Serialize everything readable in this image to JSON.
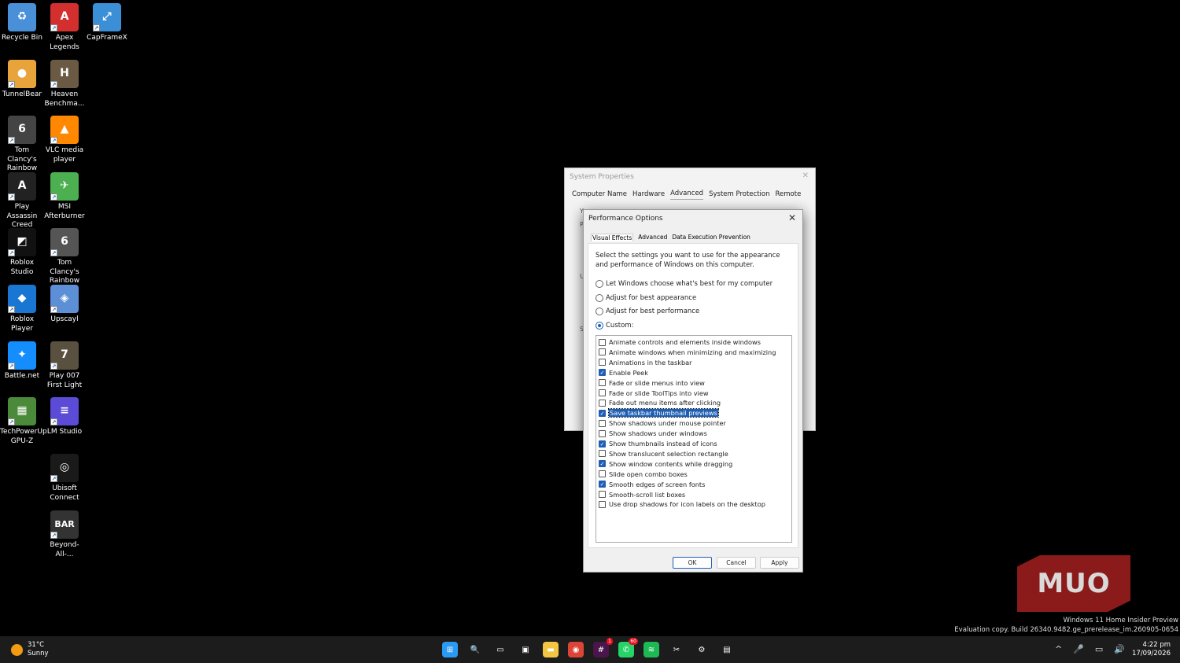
{
  "desktop_icons": [
    {
      "label": "Recycle Bin",
      "icon": "recycle-bin-icon",
      "color": "#4a90d9",
      "glyph": "♻"
    },
    {
      "label": "Apex Legends",
      "icon": "apex-legends-icon",
      "color": "#d32f2f",
      "glyph": "A"
    },
    {
      "label": "CapFrameX",
      "icon": "capframex-icon",
      "color": "#3b8fd6",
      "glyph": "⤢"
    },
    {
      "label": "TunnelBear",
      "icon": "tunnelbear-icon",
      "color": "#e8a33a",
      "glyph": "●"
    },
    {
      "label": "Heaven Benchma...",
      "icon": "heaven-benchmark-icon",
      "color": "#6b5a43",
      "glyph": "H"
    },
    {
      "label": "Tom Clancy's Rainbow Si...",
      "icon": "rainbow-six-icon",
      "color": "#444444",
      "glyph": "6"
    },
    {
      "label": "VLC media player",
      "icon": "vlc-icon",
      "color": "#ff8800",
      "glyph": "▲"
    },
    {
      "label": "Play Assassin Creed Blac...",
      "icon": "assassins-creed-icon",
      "color": "#222222",
      "glyph": "A"
    },
    {
      "label": "MSI Afterburner",
      "icon": "msi-afterburner-icon",
      "color": "#4caf50",
      "glyph": "✈"
    },
    {
      "label": "Roblox Studio",
      "icon": "roblox-studio-icon",
      "color": "#111111",
      "glyph": "◩"
    },
    {
      "label": "Tom Clancy's Rainbow Si...",
      "icon": "rainbow-six-siege-icon",
      "color": "#555555",
      "glyph": "6"
    },
    {
      "label": "Roblox Player",
      "icon": "roblox-player-icon",
      "color": "#1976d2",
      "glyph": "◆"
    },
    {
      "label": "Upscayl",
      "icon": "upscayl-icon",
      "color": "#5c8fd6",
      "glyph": "◈"
    },
    {
      "label": "Battle.net",
      "icon": "battlenet-icon",
      "color": "#148eff",
      "glyph": "✦"
    },
    {
      "label": "Play 007 First Light",
      "icon": "007-first-light-icon",
      "color": "#5a5040",
      "glyph": "7"
    },
    {
      "label": "TechPowerUp GPU-Z",
      "icon": "gpu-z-icon",
      "color": "#4a8a3a",
      "glyph": "▦"
    },
    {
      "label": "LM Studio",
      "icon": "lm-studio-icon",
      "color": "#5b4bd6",
      "glyph": "≡"
    },
    {
      "label": "Ubisoft Connect",
      "icon": "ubisoft-connect-icon",
      "color": "#1a1a1a",
      "glyph": "◎"
    },
    {
      "label": "Beyond-All-...",
      "icon": "beyond-all-reason-icon",
      "color": "#333333",
      "glyph": "BAR"
    }
  ],
  "system_properties": {
    "title": "System Properties",
    "tabs": [
      "Computer Name",
      "Hardware",
      "Advanced",
      "System Protection",
      "Remote"
    ],
    "active_tab": "Advanced"
  },
  "performance_options": {
    "title": "Performance Options",
    "tabs": [
      "Visual Effects",
      "Advanced",
      "Data Execution Prevention"
    ],
    "active_tab": "Visual Effects",
    "description": "Select the settings you want to use for the appearance and performance of Windows on this computer.",
    "radio_options": [
      {
        "label": "Let Windows choose what's best for my computer",
        "selected": false
      },
      {
        "label": "Adjust for best appearance",
        "selected": false
      },
      {
        "label": "Adjust for best performance",
        "selected": false
      },
      {
        "label": "Custom:",
        "selected": true
      }
    ],
    "effects": [
      {
        "label": "Animate controls and elements inside windows",
        "checked": false
      },
      {
        "label": "Animate windows when minimizing and maximizing",
        "checked": false
      },
      {
        "label": "Animations in the taskbar",
        "checked": false
      },
      {
        "label": "Enable Peek",
        "checked": true
      },
      {
        "label": "Fade or slide menus into view",
        "checked": false
      },
      {
        "label": "Fade or slide ToolTips into view",
        "checked": false
      },
      {
        "label": "Fade out menu items after clicking",
        "checked": false
      },
      {
        "label": "Save taskbar thumbnail previews",
        "checked": true,
        "highlighted": true
      },
      {
        "label": "Show shadows under mouse pointer",
        "checked": false
      },
      {
        "label": "Show shadows under windows",
        "checked": false
      },
      {
        "label": "Show thumbnails instead of icons",
        "checked": true
      },
      {
        "label": "Show translucent selection rectangle",
        "checked": false
      },
      {
        "label": "Show window contents while dragging",
        "checked": true
      },
      {
        "label": "Slide open combo boxes",
        "checked": false
      },
      {
        "label": "Smooth edges of screen fonts",
        "checked": true
      },
      {
        "label": "Smooth-scroll list boxes",
        "checked": false
      },
      {
        "label": "Use drop shadows for icon labels on the desktop",
        "checked": false
      }
    ],
    "buttons": {
      "ok": "OK",
      "cancel": "Cancel",
      "apply": "Apply"
    }
  },
  "watermark": {
    "logo": "MUO",
    "windows_line1": "Windows 11 Home Insider Preview",
    "windows_line2": "Evaluation copy. Build 26340.9482.ge_prerelease_im.260905-0654"
  },
  "taskbar": {
    "weather_temp": "31°C",
    "weather_desc": "Sunny",
    "apps": [
      {
        "icon": "start-icon",
        "color": "#2b9af3",
        "glyph": "⊞"
      },
      {
        "icon": "search-icon",
        "color": "#1c1c1c",
        "glyph": "🔍"
      },
      {
        "icon": "task-view-icon",
        "color": "#1c1c1c",
        "glyph": "▭"
      },
      {
        "icon": "microsoft-store-icon",
        "color": "#1c1c1c",
        "glyph": "▣"
      },
      {
        "icon": "file-explorer-icon",
        "color": "#f4c542",
        "glyph": "▬"
      },
      {
        "icon": "chrome-icon",
        "color": "#db4437",
        "glyph": "◉"
      },
      {
        "icon": "slack-icon",
        "color": "#4a154b",
        "glyph": "#",
        "badge": "1"
      },
      {
        "icon": "whatsapp-icon",
        "color": "#25d366",
        "glyph": "✆",
        "badge": "60"
      },
      {
        "icon": "spotify-icon",
        "color": "#1db954",
        "glyph": "≋"
      },
      {
        "icon": "snipping-tool-icon",
        "color": "#1c1c1c",
        "glyph": "✂"
      },
      {
        "icon": "settings-icon",
        "color": "#1c1c1c",
        "glyph": "⚙"
      },
      {
        "icon": "system-properties-icon",
        "color": "#1c1c1c",
        "glyph": "▤"
      }
    ],
    "tray": [
      "^",
      "🎤",
      "▭",
      "🔊"
    ],
    "time": "4:22 pm",
    "date": "17/09/2026"
  }
}
